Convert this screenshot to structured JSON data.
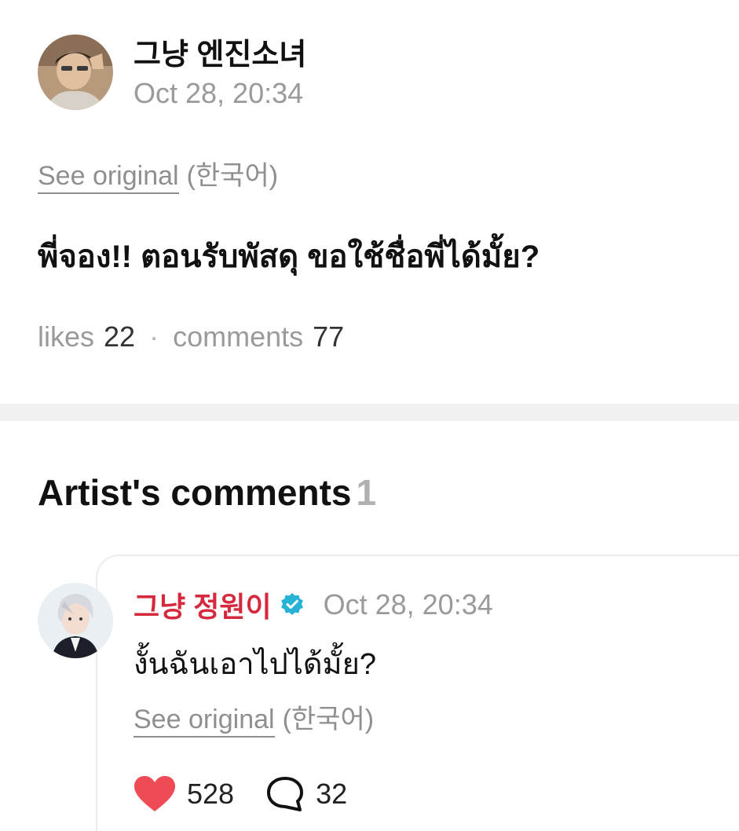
{
  "post": {
    "author": "그냥 엔진소녀",
    "time": "Oct 28, 20:34",
    "see_original": "See original",
    "language": "(한국어)",
    "body": "พี่จอง!! ตอนรับพัสดุ ขอใช้ชื่อพี่ได้มั้ย?",
    "likes_label": "likes",
    "likes_count": "22",
    "separator": "·",
    "comments_label": "comments",
    "comments_count": "77"
  },
  "artist_comments": {
    "title": "Artist's comments",
    "count": "1",
    "items": [
      {
        "author": "그냥 정원이",
        "verified_icon": "verified-badge-icon",
        "time": "Oct 28, 20:34",
        "body": "งั้นฉันเอาไปได้มั้ย?",
        "see_original": "See original",
        "language": "(한국어)",
        "like_count": "528",
        "reply_count": "32",
        "like_icon": "heart-icon",
        "reply_icon": "speech-bubble-icon"
      }
    ]
  },
  "colors": {
    "artist_name": "#d6293e",
    "heart": "#ef4b56",
    "verified": "#27b2d6",
    "muted_text": "#9a9a9a"
  }
}
